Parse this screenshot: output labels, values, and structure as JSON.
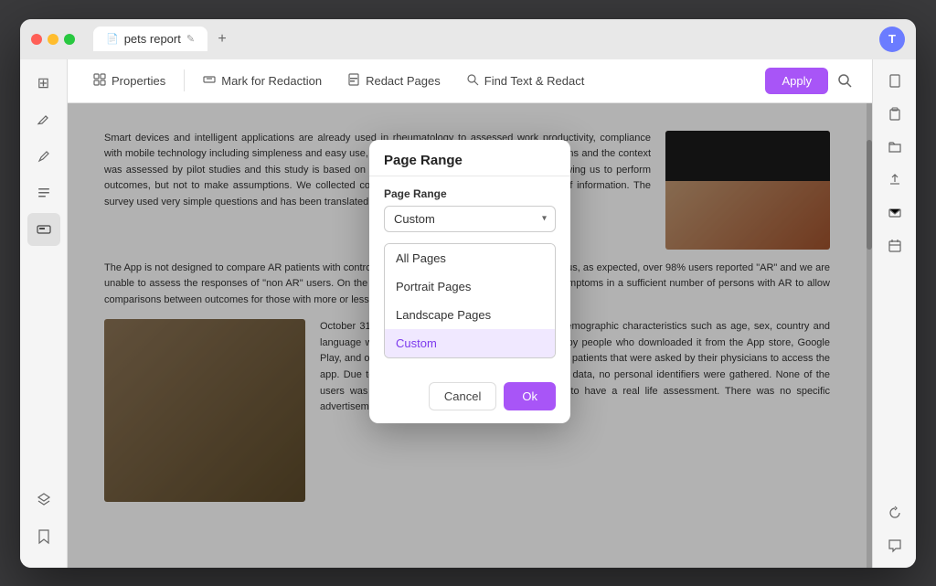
{
  "titlebar": {
    "tab_name": "pets report",
    "add_tab_label": "+",
    "avatar_label": "T"
  },
  "toolbar": {
    "properties_label": "Properties",
    "mark_for_redaction_label": "Mark for Redaction",
    "redact_pages_label": "Redact Pages",
    "find_text_redact_label": "Find Text & Redact",
    "apply_label": "Apply"
  },
  "modal": {
    "title": "Page Range",
    "label": "Page Range",
    "selected_value": "Custom",
    "options": [
      {
        "value": "all_pages",
        "label": "All Pages"
      },
      {
        "value": "portrait_pages",
        "label": "Portrait Pages"
      },
      {
        "value": "landscape_pages",
        "label": "Landscape Pages"
      },
      {
        "value": "custom",
        "label": "Custom"
      }
    ],
    "cancel_label": "Cancel",
    "ok_label": "Ok"
  },
  "doc": {
    "paragraph1": "Smart devices and intelligent applications are already used in rheumatology to assessed work productivity, compliance with mobile technology including simpleness and easy use, but the right application, appropriate questions and the context was assessed by pilot studies and this study is based on 1,136 users who used the Allergy VAS allowing us to perform outcomes, but not to make assumptions. We collected country, language, age group, date of entry of information. The survey used very simple questions and has been translated into 15 languages.",
    "paragraph2": "The App is not designed to compare AR patients with control subjects and this was not a clinical trial. Thus, as expected, over 98% users reported \"AR\" and we are unable to assess the responses of \"non AR\" users. On the other hand, there are many days with no symptoms in a sufficient number of persons with AR to allow comparisons between outcomes for those with more or less symptoms.",
    "paragraph3": "October 31, 2016 were included in the study. Some demographic characteristics such as age, sex, country and language were recorded. The Allergy Diary was used by people who downloaded it from the App store, Google Play, and other internet sources. A few users were clinic patients that were asked by their physicians to access the app. Due to anonymization (i.e. name and address) of data, no personal identifiers were gathered. None of the users was enrolled in a clinical study as we aimed to have a real life assessment. There was no specific advertisement or other recruitment campaign"
  },
  "sidebar": {
    "icons": [
      "⊞",
      "🔏",
      "✏",
      "☰",
      "📋",
      "🔖",
      "⊗",
      "🔖"
    ]
  },
  "right_sidebar": {
    "icons": [
      "📄",
      "📋",
      "📁",
      "⬆",
      "✉",
      "📅"
    ]
  }
}
